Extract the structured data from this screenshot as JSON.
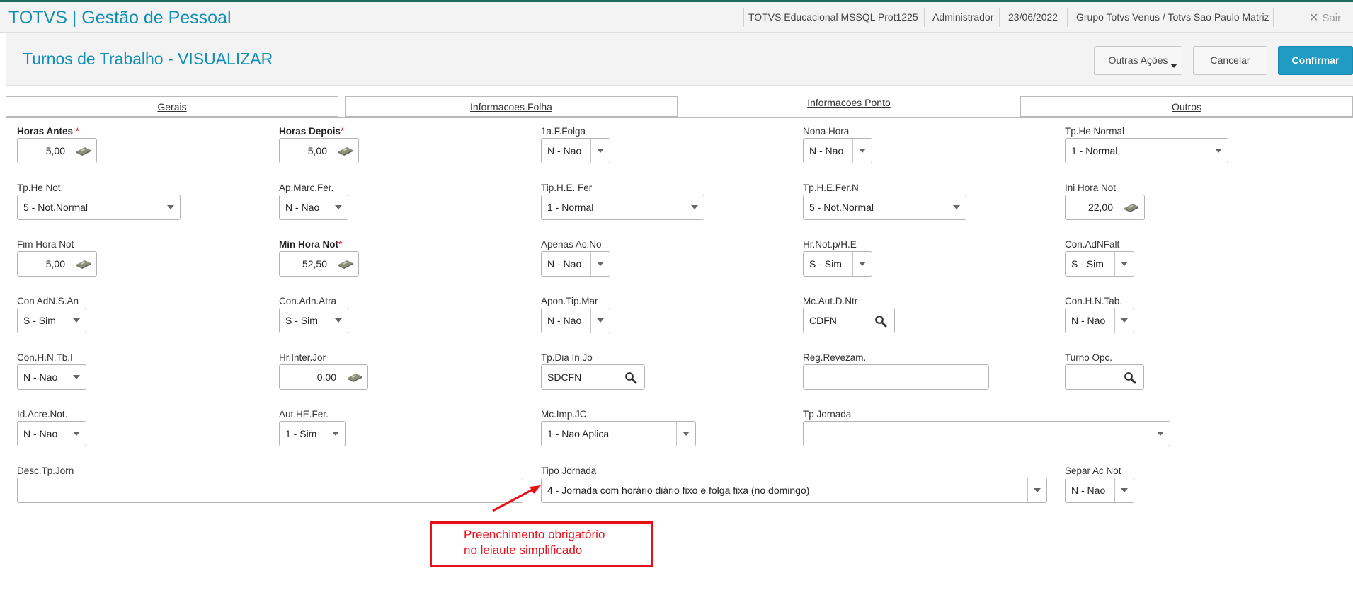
{
  "header": {
    "brand": "TOTVS | Gestão de Pessoal",
    "database": "TOTVS Educacional MSSQL Prot1225",
    "user": "Administrador",
    "date": "23/06/2022",
    "company": "Grupo Totvs Venus / Totvs Sao Paulo Matriz",
    "exit_label": "Sair",
    "exit_icon": "close-icon"
  },
  "page": {
    "title": "Turnos de Trabalho - VISUALIZAR",
    "actions": {
      "outras": "Outras Ações",
      "cancelar": "Cancelar",
      "confirmar": "Confirmar"
    },
    "accent_color": "#1f9bc4"
  },
  "tabs": [
    {
      "label": "Gerais",
      "active": false
    },
    {
      "label": "Informacoes Folha",
      "active": false
    },
    {
      "label": "Informacoes Ponto",
      "active": true
    },
    {
      "label": "Outros",
      "active": false
    }
  ],
  "fields": {
    "horas_antes": {
      "label": "Horas Antes",
      "value": "5,00",
      "required": true
    },
    "horas_depois": {
      "label": "Horas Depois",
      "value": "5,00",
      "required": true
    },
    "folga_1a": {
      "label": "1a.F.Folga",
      "value": "N - Nao"
    },
    "nona_hora": {
      "label": "Nona Hora",
      "value": "N - Nao"
    },
    "tp_he_normal": {
      "label": "Tp.He Normal",
      "value": "1 - Normal"
    },
    "tp_he_not": {
      "label": "Tp.He Not.",
      "value": "5 - Not.Normal"
    },
    "ap_marc_fer": {
      "label": "Ap.Marc.Fer.",
      "value": "N - Nao"
    },
    "tip_he_fer": {
      "label": "Tip.H.E. Fer",
      "value": "1 - Normal"
    },
    "tp_he_fer_n": {
      "label": "Tp.H.E.Fer.N",
      "value": "5 - Not.Normal"
    },
    "ini_hora_not": {
      "label": "Ini Hora Not",
      "value": "22,00"
    },
    "fim_hora_not": {
      "label": "Fim Hora Not",
      "value": "5,00"
    },
    "min_hora_not": {
      "label": "Min Hora Not",
      "value": "52,50",
      "required": true
    },
    "apenas_ac_no": {
      "label": "Apenas Ac.No",
      "value": "N - Nao"
    },
    "hr_not_he": {
      "label": "Hr.Not.p/H.E",
      "value": "S - Sim"
    },
    "con_adnfalt": {
      "label": "Con.AdNFalt",
      "value": "S - Sim"
    },
    "con_adn_s_an": {
      "label": "Con AdN.S.An",
      "value": "S - Sim"
    },
    "con_adn_atra": {
      "label": "Con.Adn.Atra",
      "value": "S - Sim"
    },
    "apon_tip_mar": {
      "label": "Apon.Tip.Mar",
      "value": "N - Nao"
    },
    "mc_aut_d_ntr": {
      "label": "Mc.Aut.D.Ntr",
      "value": "CDFN"
    },
    "con_h_n_tab": {
      "label": "Con.H.N.Tab.",
      "value": "N - Nao"
    },
    "con_h_n_tb_i": {
      "label": "Con.H.N.Tb.I",
      "value": "N - Nao"
    },
    "hr_inter_jor": {
      "label": "Hr.Inter.Jor",
      "value": "0,00"
    },
    "tp_dia_in_jo": {
      "label": "Tp.Dia In.Jo",
      "value": "SDCFN"
    },
    "reg_revezam": {
      "label": "Reg.Revezam.",
      "value": ""
    },
    "turno_opc": {
      "label": "Turno Opc.",
      "value": ""
    },
    "id_acre_not": {
      "label": "Id.Acre.Not.",
      "value": "N - Nao"
    },
    "aut_he_fer": {
      "label": "Aut.HE.Fer.",
      "value": "1 - Sim"
    },
    "mc_imp_jc": {
      "label": "Mc.Imp.JC.",
      "value": "1 - Nao Aplica"
    },
    "tp_jornada": {
      "label": "Tp Jornada",
      "value": ""
    },
    "desc_tp_jorn": {
      "label": "Desc.Tp.Jorn",
      "value": ""
    },
    "tipo_jornada": {
      "label": "Tipo Jornada",
      "value": "4 - Jornada com horário diário fixo e folga fixa (no domingo)"
    },
    "separ_ac_not": {
      "label": "Separ Ac Not",
      "value": "N - Nao"
    }
  },
  "annotation": {
    "line1": "Preenchimento obrigatório",
    "line2": "no leiaute simplificado",
    "color": "#e8111b"
  }
}
